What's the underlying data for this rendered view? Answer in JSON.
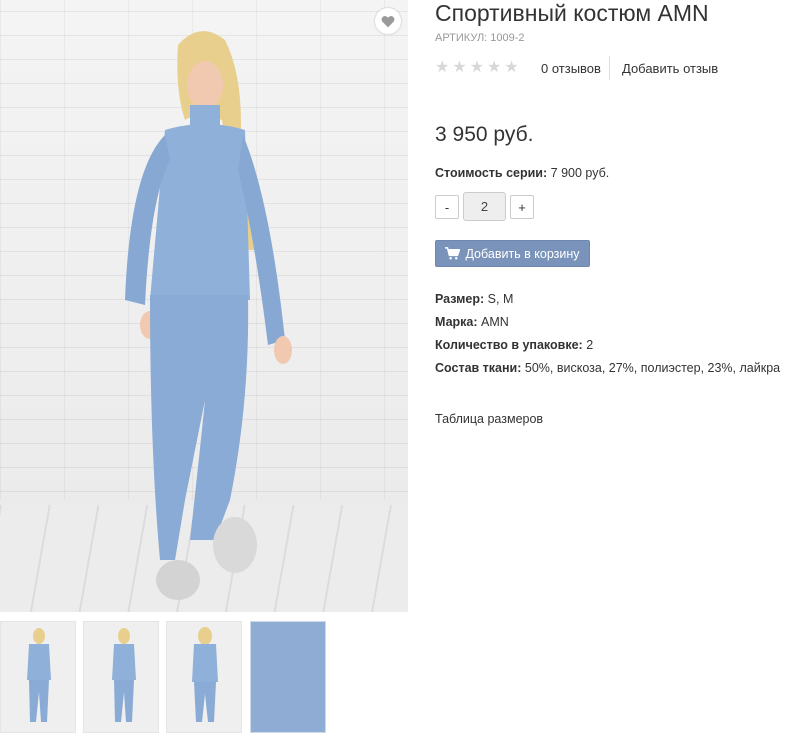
{
  "product": {
    "title": "Спортивный костюм AMN",
    "sku": "АРТИКУЛ: 1009-2",
    "reviews_count": "0 отзывов",
    "add_review": "Добавить отзыв",
    "rating_stars": 0,
    "price": "3 950 руб.",
    "series_label": "Стоимость серии:",
    "series_value": " 7 900 руб.",
    "quantity": {
      "minus": "-",
      "value": "2",
      "plus": "+"
    },
    "add_to_cart": "Добавить в корзину",
    "properties": [
      {
        "label": "Размер:",
        "value": " S, M"
      },
      {
        "label": "Марка:",
        "value": " AMN"
      },
      {
        "label": "Количество в упаковке:",
        "value": " 2"
      },
      {
        "label": "Состав ткани:",
        "value": " 50%, вискоза, 27%, полиэстер, 23%, лайкра"
      }
    ],
    "size_table_link": "Таблица размеров"
  },
  "colors": {
    "button": "#7a93bb",
    "outfit": "#8fb0d8",
    "text": "#333333",
    "muted": "#999999",
    "star_empty": "#d8d8d8"
  },
  "icons": {
    "wishlist": "heart-icon",
    "cart": "shopping-cart-icon",
    "star": "star-icon"
  }
}
